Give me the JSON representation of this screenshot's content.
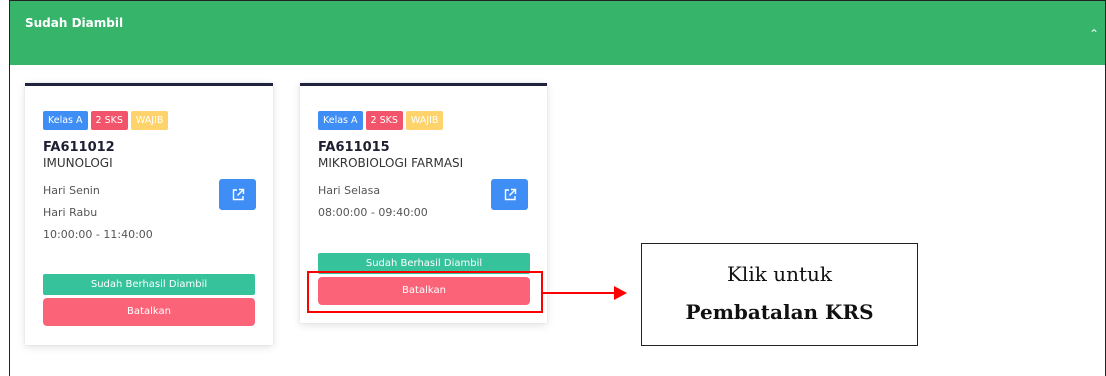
{
  "header": {
    "title": "Sudah Diambil",
    "collapse_icon": "chevron-up-icon"
  },
  "courses": [
    {
      "badges": [
        "Kelas A",
        "2 SKS",
        "WAJIB"
      ],
      "code": "FA611012",
      "name": "IMUNOLOGI",
      "schedule": [
        "Hari Senin",
        "Hari Rabu",
        "10:00:00 - 11:40:00"
      ],
      "status": "Sudah Berhasil Diambil",
      "cancel": "Batalkan"
    },
    {
      "badges": [
        "Kelas A",
        "2 SKS",
        "WAJIB"
      ],
      "code": "FA611015",
      "name": "MIKROBIOLOGI FARMASI",
      "schedule": [
        "Hari Selasa",
        "08:00:00 - 09:40:00"
      ],
      "status": "Sudah Berhasil Diambil",
      "cancel": "Batalkan"
    }
  ],
  "annotation": {
    "line1": "Klik untuk",
    "line2": "Pembatalan KRS"
  },
  "colors": {
    "header": "#36b56a",
    "kelas": "#3e8ef5",
    "sks": "#f2546c",
    "wajib": "#ffd36b",
    "status": "#36c29b",
    "cancel": "#fb6478",
    "highlight": "#ff0000"
  }
}
